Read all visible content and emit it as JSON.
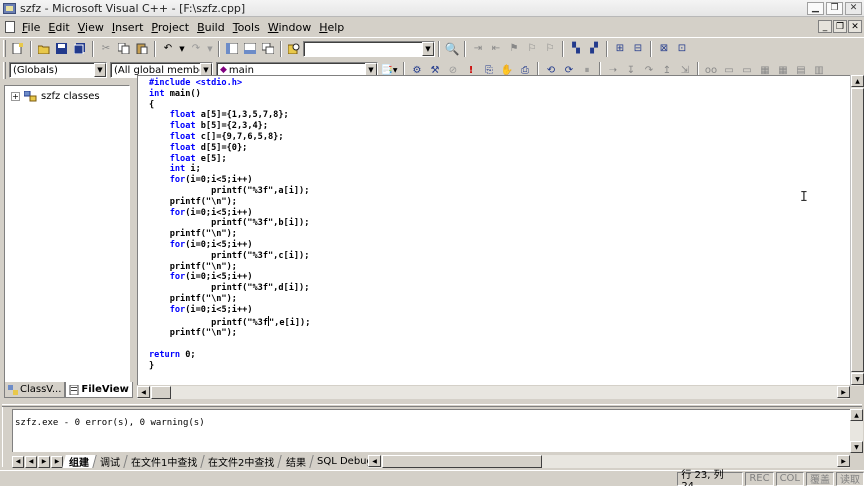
{
  "window": {
    "title": "szfz - Microsoft Visual C++ - [F:\\szfz.cpp]"
  },
  "menu": {
    "items": [
      {
        "label": "File",
        "key": "F",
        "rest": "ile"
      },
      {
        "label": "Edit",
        "key": "E",
        "rest": "dit"
      },
      {
        "label": "View",
        "key": "V",
        "rest": "iew"
      },
      {
        "label": "Insert",
        "key": "I",
        "rest": "nsert"
      },
      {
        "label": "Project",
        "key": "P",
        "rest": "roject"
      },
      {
        "label": "Build",
        "key": "B",
        "rest": "uild"
      },
      {
        "label": "Tools",
        "key": "T",
        "rest": "ools"
      },
      {
        "label": "Window",
        "key": "W",
        "rest": "indow"
      },
      {
        "label": "Help",
        "key": "H",
        "rest": "elp"
      }
    ]
  },
  "toolbar": {
    "find_value": "",
    "scope_combo": "(Globals)",
    "members_combo": "(All global members",
    "function_combo": "main"
  },
  "workspace": {
    "tree_root": "szfz classes",
    "tabs": [
      {
        "label": "ClassV...",
        "active": false
      },
      {
        "label": "FileView",
        "active": true
      }
    ]
  },
  "editor": {
    "lines": [
      [
        {
          "t": "#include <stdio.h>",
          "k": true
        }
      ],
      [
        {
          "t": "int",
          "k": true
        },
        {
          "t": " main()"
        }
      ],
      [
        {
          "t": "{"
        }
      ],
      [
        {
          "t": "    "
        },
        {
          "t": "float",
          "k": true
        },
        {
          "t": " a[5]={1,3,5,7,8};"
        }
      ],
      [
        {
          "t": "    "
        },
        {
          "t": "float",
          "k": true
        },
        {
          "t": " b[5]={2,3,4};"
        }
      ],
      [
        {
          "t": "    "
        },
        {
          "t": "float",
          "k": true
        },
        {
          "t": " c[]={9,7,6,5,8};"
        }
      ],
      [
        {
          "t": "    "
        },
        {
          "t": "float",
          "k": true
        },
        {
          "t": " d[5]={0};"
        }
      ],
      [
        {
          "t": "    "
        },
        {
          "t": "float",
          "k": true
        },
        {
          "t": " e[5];"
        }
      ],
      [
        {
          "t": "    "
        },
        {
          "t": "int",
          "k": true
        },
        {
          "t": " i;"
        }
      ],
      [
        {
          "t": "    "
        },
        {
          "t": "for",
          "k": true
        },
        {
          "t": "(i=0;i<5;i++)"
        }
      ],
      [
        {
          "t": "            printf(\"%3f\",a[i]);"
        }
      ],
      [
        {
          "t": "    printf(\"\\n\");"
        }
      ],
      [
        {
          "t": "    "
        },
        {
          "t": "for",
          "k": true
        },
        {
          "t": "(i=0;i<5;i++)"
        }
      ],
      [
        {
          "t": "            printf(\"%3f\",b[i]);"
        }
      ],
      [
        {
          "t": "    printf(\"\\n\");"
        }
      ],
      [
        {
          "t": "    "
        },
        {
          "t": "for",
          "k": true
        },
        {
          "t": "(i=0;i<5;i++)"
        }
      ],
      [
        {
          "t": "            printf(\"%3f\",c[i]);"
        }
      ],
      [
        {
          "t": "    printf(\"\\n\");"
        }
      ],
      [
        {
          "t": "    "
        },
        {
          "t": "for",
          "k": true
        },
        {
          "t": "(i=0;i<5;i++)"
        }
      ],
      [
        {
          "t": "            printf(\"%3f\",d[i]);"
        }
      ],
      [
        {
          "t": "    printf(\"\\n\");"
        }
      ],
      [
        {
          "t": "    "
        },
        {
          "t": "for",
          "k": true
        },
        {
          "t": "(i=0;i<5;i++)"
        }
      ],
      [
        {
          "t": "            printf(\"%3f"
        },
        {
          "caret": true
        },
        {
          "t": "\",e[i]);"
        }
      ],
      [
        {
          "t": "    printf(\"\\n\");"
        }
      ],
      [
        {
          "t": ""
        }
      ],
      [
        {
          "t": "return",
          "k": true
        },
        {
          "t": " 0;"
        }
      ],
      [
        {
          "t": "}"
        }
      ]
    ]
  },
  "output": {
    "text": "szfz.exe - 0 error(s), 0 warning(s)",
    "tabs": [
      {
        "label": "组建",
        "active": true
      },
      {
        "label": "调试",
        "active": false
      },
      {
        "label": "在文件1中查找",
        "active": false
      },
      {
        "label": "在文件2中查找",
        "active": false
      },
      {
        "label": "结果",
        "active": false
      },
      {
        "label": "SQL Debugging",
        "active": false
      }
    ]
  },
  "status": {
    "message": "",
    "position": "行 23, 列 24",
    "indicators": [
      "REC",
      "COL",
      "覆盖",
      "读取"
    ]
  },
  "colors": {
    "keyword": "#0000ff",
    "face": "#d4d0c8"
  }
}
